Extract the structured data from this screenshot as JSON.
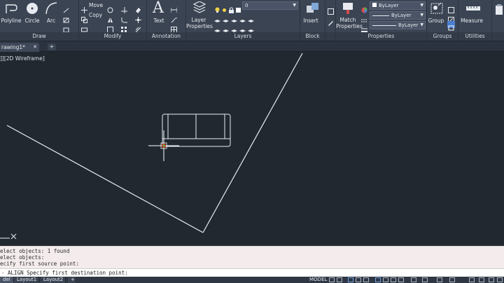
{
  "ribbon": {
    "draw": {
      "footer": "Draw",
      "polyline": "Polyline",
      "circle": "Circle",
      "arc": "Arc"
    },
    "modify": {
      "footer": "Modify",
      "move": "Move",
      "copy": "Copy"
    },
    "annotation": {
      "footer": "Annotation",
      "text": "Text"
    },
    "layers": {
      "footer": "Layers",
      "layer_properties_line1": "Layer",
      "layer_properties_line2": "Properties",
      "current_layer": "0"
    },
    "block": {
      "footer": "Block",
      "insert": "Insert"
    },
    "properties": {
      "footer": "Properties",
      "match_line1": "Match",
      "match_line2": "Properties",
      "color": "ByLayer",
      "linetype": "ByLayer",
      "lineweight": "ByLayer"
    },
    "groups": {
      "footer": "Groups",
      "group": "Group"
    },
    "utilities": {
      "footer": "Utilities",
      "measure": "Measure"
    }
  },
  "tabs": {
    "drawing": "rawing1*"
  },
  "viewport": {
    "label": "]][2D Wireframe]"
  },
  "history": {
    "line1": "elect objects: 1 found",
    "line2": "elect objects:",
    "line3": "ecify first source point:"
  },
  "command": {
    "prefix": "-",
    "text": "ALIGN Specify first destination point:"
  },
  "statusbar": {
    "model_tab": "del",
    "layout1": "Layout1",
    "layout2": "Layout2",
    "model_label": "MODEL"
  }
}
